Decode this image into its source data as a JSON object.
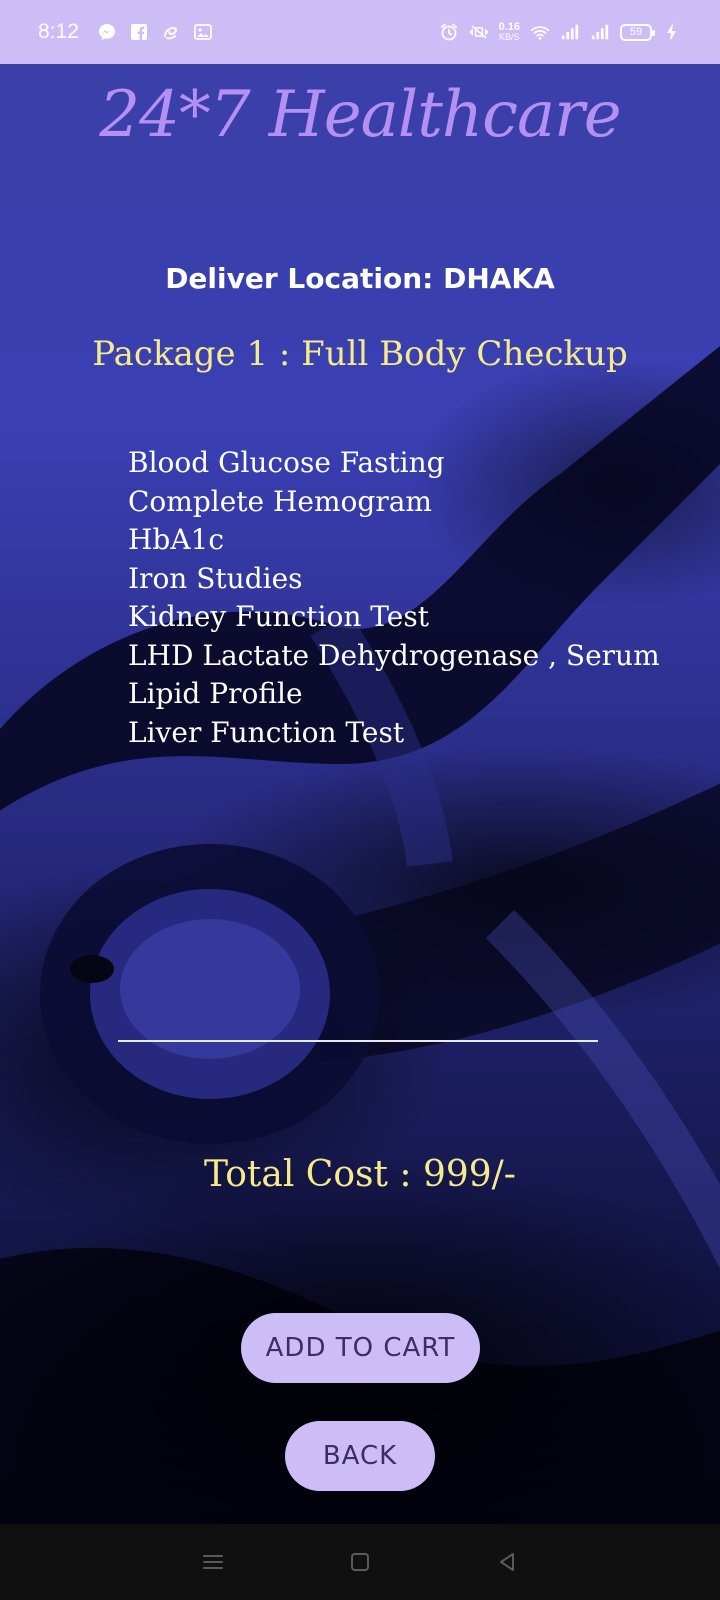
{
  "status_bar": {
    "time": "8:12",
    "net_speed_value": "0.16",
    "net_speed_unit": "KB/S",
    "battery_level": "59",
    "colors": {
      "background": "#cdbdf7",
      "foreground": "#ffffff"
    },
    "left_icons": [
      "messenger-icon",
      "facebook-icon",
      "airtel-icon",
      "gallery-icon"
    ],
    "right_icons": [
      "alarm-icon",
      "mute-vibrate-icon",
      "wifi-icon",
      "signal-icon",
      "signal-icon",
      "battery-icon",
      "charging-icon"
    ]
  },
  "app": {
    "title": "24*7 Healthcare",
    "location_label": "Deliver Location: DHAKA",
    "package_title": "Package 1 : Full Body Checkup",
    "tests": [
      "Blood Glucose Fasting",
      "Complete Hemogram",
      "HbA1c",
      "Iron Studies",
      "Kidney Function Test",
      "LHD Lactate Dehydrogenase , Serum",
      "Lipid Profile",
      "Liver Function Test"
    ],
    "total_cost": "Total Cost : 999/-",
    "buttons": {
      "add_to_cart": "ADD TO CART",
      "back": "BACK"
    },
    "colors": {
      "title": "#b490f2",
      "highlight": "#f5eb8b",
      "button": "#cdbdf7",
      "button_text": "#3a2d6b"
    }
  },
  "nav_bar": {
    "buttons": [
      "menu-icon",
      "home-icon",
      "back-icon"
    ]
  }
}
